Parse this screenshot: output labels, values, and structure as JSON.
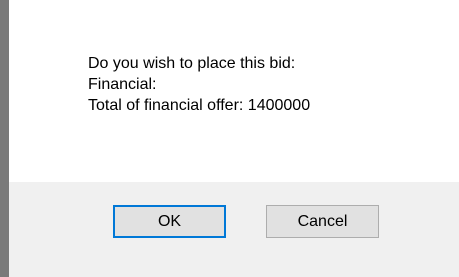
{
  "message": {
    "line1": "Do you wish to place this bid:",
    "line2": "Financial:",
    "line3": "Total of financial offer: 1400000"
  },
  "buttons": {
    "ok_label": "OK",
    "cancel_label": "Cancel"
  },
  "colors": {
    "default_button_border": "#0078d7",
    "button_area_bg": "#f0f0f0",
    "window_edge": "#7a7a7a"
  }
}
